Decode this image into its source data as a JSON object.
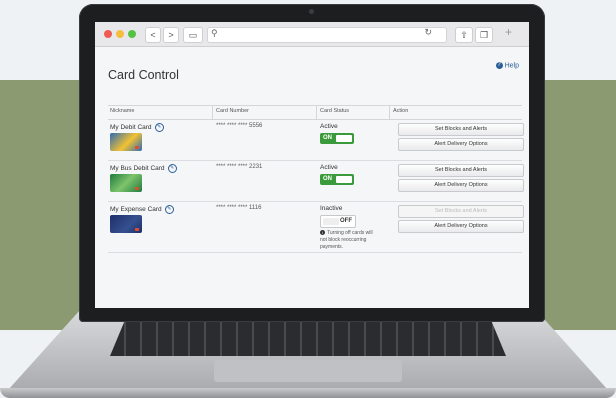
{
  "browser": {
    "address": "",
    "back": "<",
    "forward": ">"
  },
  "page": {
    "title": "Card Control",
    "help": "Help"
  },
  "table": {
    "headers": [
      "Nickname",
      "Card Number",
      "Card Status",
      "Action"
    ],
    "rows": [
      {
        "nickname": "My Debit Card",
        "number": "**** **** **** 5556",
        "status": "Active",
        "toggle": "ON",
        "actions": [
          "Set Blocks and Alerts",
          "Alert Delivery Options"
        ]
      },
      {
        "nickname": "My Bus Debit Card",
        "number": "**** **** **** 2231",
        "status": "Active",
        "toggle": "ON",
        "actions": [
          "Set Blocks and Alerts",
          "Alert Delivery Options"
        ]
      },
      {
        "nickname": "My Expense Card",
        "number": "**** **** **** 1116",
        "status": "Inactive",
        "toggle": "OFF",
        "note": "Turning off cards will not block reoccurring payments.",
        "actions": [
          "Set Blocks and Alerts",
          "Alert Delivery Options"
        ]
      }
    ]
  },
  "colors": {
    "accent": "#2b5f9a",
    "toggle_on": "#3b9a3b",
    "band": "#8c9a71"
  }
}
